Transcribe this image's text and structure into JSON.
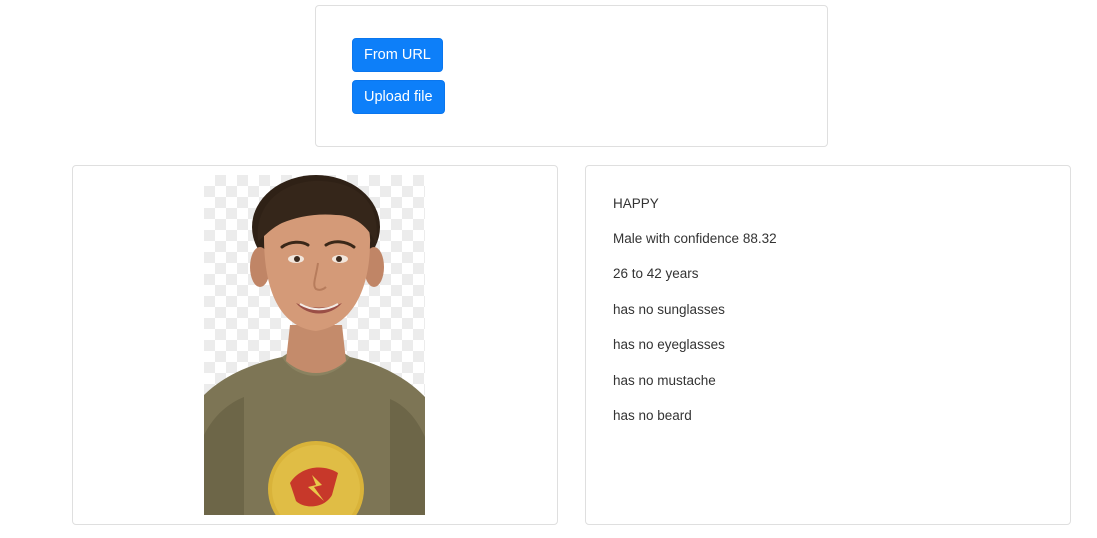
{
  "actions": {
    "from_url_label": "From URL",
    "upload_file_label": "Upload file"
  },
  "result": {
    "emotion": "HAPPY",
    "gender": "Male with confidence 88.32",
    "age_range": "26 to 42 years",
    "sunglasses": "has no sunglasses",
    "eyeglasses": "has no eyeglasses",
    "mustache": "has no mustache",
    "beard": "has no beard"
  },
  "colors": {
    "button": "#0d7ff9",
    "card_border": "#dfdfdf"
  }
}
